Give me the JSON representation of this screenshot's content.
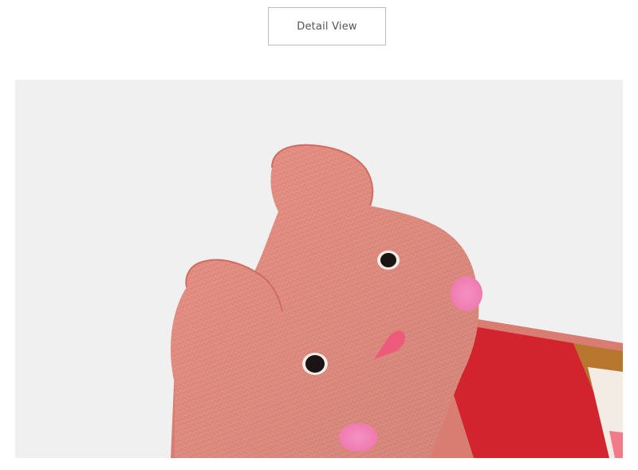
{
  "header": {
    "button_label": "Detail View"
  },
  "photo": {
    "subject": "pink-cat-sock-closeup",
    "colors": {
      "background": "#f1f0f0",
      "sock_pink": "#e89286",
      "sock_pink_dark": "#d8766c",
      "cheek": "#f27fb6",
      "nose": "#ee5a79",
      "eye": "#1a1414",
      "stripe_red": "#d1242f",
      "stripe_brown": "#b8772e",
      "stripe_cream": "#f3ece4",
      "stripe_pink": "#f07c8a"
    }
  }
}
